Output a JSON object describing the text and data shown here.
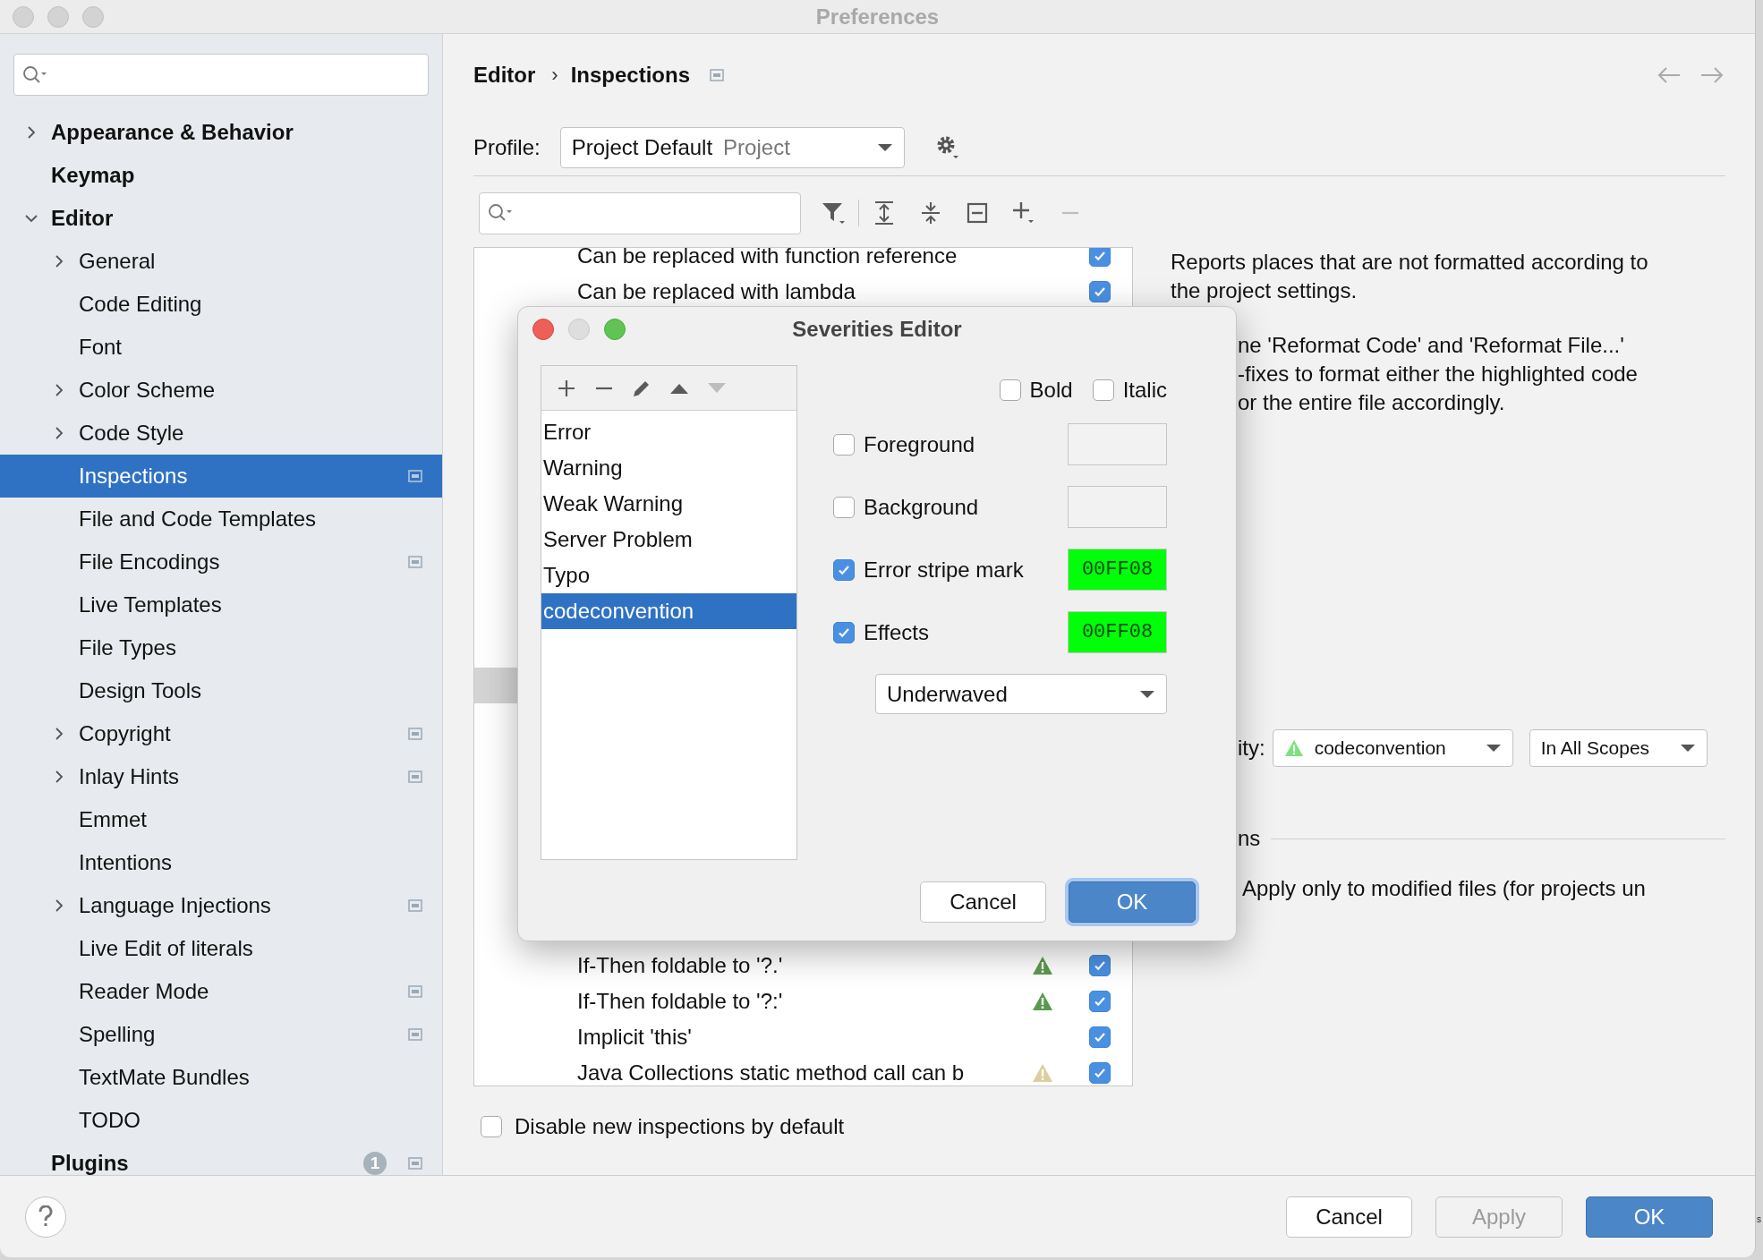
{
  "window": {
    "title": "Preferences"
  },
  "sidebar": {
    "items": [
      {
        "label": "Appearance & Behavior",
        "expandable": true,
        "expanded": false,
        "selected": false,
        "project_scoped": false
      },
      {
        "label": "Keymap",
        "expandable": false,
        "expanded": false,
        "selected": false,
        "project_scoped": false
      },
      {
        "label": "Editor",
        "expandable": true,
        "expanded": true,
        "selected": false,
        "project_scoped": false,
        "children": [
          {
            "label": "General",
            "expandable": true,
            "expanded": false,
            "selected": false,
            "project_scoped": false
          },
          {
            "label": "Code Editing",
            "expandable": false,
            "expanded": false,
            "selected": false,
            "project_scoped": false
          },
          {
            "label": "Font",
            "expandable": false,
            "expanded": false,
            "selected": false,
            "project_scoped": false
          },
          {
            "label": "Color Scheme",
            "expandable": true,
            "expanded": false,
            "selected": false,
            "project_scoped": false
          },
          {
            "label": "Code Style",
            "expandable": true,
            "expanded": false,
            "selected": false,
            "project_scoped": false
          },
          {
            "label": "Inspections",
            "expandable": false,
            "expanded": false,
            "selected": true,
            "project_scoped": true
          },
          {
            "label": "File and Code Templates",
            "expandable": false,
            "expanded": false,
            "selected": false,
            "project_scoped": false
          },
          {
            "label": "File Encodings",
            "expandable": false,
            "expanded": false,
            "selected": false,
            "project_scoped": true
          },
          {
            "label": "Live Templates",
            "expandable": false,
            "expanded": false,
            "selected": false,
            "project_scoped": false
          },
          {
            "label": "File Types",
            "expandable": false,
            "expanded": false,
            "selected": false,
            "project_scoped": false
          },
          {
            "label": "Design Tools",
            "expandable": false,
            "expanded": false,
            "selected": false,
            "project_scoped": false
          },
          {
            "label": "Copyright",
            "expandable": true,
            "expanded": false,
            "selected": false,
            "project_scoped": true
          },
          {
            "label": "Inlay Hints",
            "expandable": true,
            "expanded": false,
            "selected": false,
            "project_scoped": true
          },
          {
            "label": "Emmet",
            "expandable": false,
            "expanded": false,
            "selected": false,
            "project_scoped": false
          },
          {
            "label": "Intentions",
            "expandable": false,
            "expanded": false,
            "selected": false,
            "project_scoped": false
          },
          {
            "label": "Language Injections",
            "expandable": true,
            "expanded": false,
            "selected": false,
            "project_scoped": true
          },
          {
            "label": "Live Edit of literals",
            "expandable": false,
            "expanded": false,
            "selected": false,
            "project_scoped": false
          },
          {
            "label": "Reader Mode",
            "expandable": false,
            "expanded": false,
            "selected": false,
            "project_scoped": true
          },
          {
            "label": "Spelling",
            "expandable": false,
            "expanded": false,
            "selected": false,
            "project_scoped": true
          },
          {
            "label": "TextMate Bundles",
            "expandable": false,
            "expanded": false,
            "selected": false,
            "project_scoped": false
          },
          {
            "label": "TODO",
            "expandable": false,
            "expanded": false,
            "selected": false,
            "project_scoped": false
          }
        ]
      },
      {
        "label": "Plugins",
        "expandable": false,
        "expanded": false,
        "selected": false,
        "project_scoped": true,
        "badge": "1"
      }
    ]
  },
  "page": {
    "breadcrumb": [
      "Editor",
      "Inspections"
    ],
    "breadcrumb_separator": "›",
    "project_scoped": true,
    "profile": {
      "label": "Profile:",
      "value": "Project Default",
      "scope": "Project"
    },
    "toolbar": [
      {
        "kind": "filter",
        "disabled": false
      },
      {
        "kind": "expand",
        "disabled": false
      },
      {
        "kind": "collapse",
        "disabled": false
      },
      {
        "kind": "reset",
        "disabled": false
      },
      {
        "kind": "add",
        "disabled": false
      },
      {
        "kind": "remove",
        "disabled": true
      }
    ],
    "inspections": [
      {
        "label": "Can be replaced with function reference",
        "checked": true,
        "selected": false
      },
      {
        "label": "Can be replaced with lambda",
        "checked": true,
        "selected": false
      },
      {
        "selected": true
      },
      {
        "label": "If-Then foldable to '?.'",
        "checked": true,
        "selected": false,
        "color": "#5b9a4e"
      },
      {
        "label": "If-Then foldable to '?:'",
        "checked": true,
        "selected": false,
        "color": "#5b9a4e"
      },
      {
        "label": "Implicit 'this'",
        "checked": true,
        "selected": false
      },
      {
        "label": "Java Collections static method call can b",
        "checked": true,
        "selected": false,
        "color": "#dccf9f"
      }
    ],
    "description": {
      "paragraph": "Reports places that are not formatted according to the project settings.",
      "partial_lines": [
        "ne 'Reformat Code' and 'Reformat File...'",
        "-fixes to format either the highlighted code",
        "or the entire file accordingly."
      ]
    },
    "severity": {
      "label": "ity:",
      "value": "codeconvention",
      "color": "#7ee07e",
      "scope": "In All Scopes"
    },
    "options": {
      "heading": "ns",
      "apply_only": "Apply only to modified files (for projects un"
    },
    "disable_new": {
      "label": "Disable new inspections by default",
      "checked": false
    }
  },
  "dialog": {
    "title": "Severities Editor",
    "toolbar": [
      {
        "kind": "add",
        "disabled": false
      },
      {
        "kind": "remove",
        "disabled": false
      },
      {
        "kind": "edit",
        "disabled": false
      },
      {
        "kind": "up",
        "disabled": false
      },
      {
        "kind": "down",
        "disabled": true
      }
    ],
    "severities": [
      {
        "label": "Error",
        "selected": false
      },
      {
        "label": "Warning",
        "selected": false
      },
      {
        "label": "Weak Warning",
        "selected": false
      },
      {
        "label": "Server Problem",
        "selected": false
      },
      {
        "label": "Typo",
        "selected": false
      },
      {
        "label": "codeconvention",
        "selected": true
      }
    ],
    "font_styles": [
      {
        "label": "Bold",
        "checked": false
      },
      {
        "label": "Italic",
        "checked": false
      }
    ],
    "attributes": [
      {
        "label": "Foreground",
        "checked": false
      },
      {
        "label": "Background",
        "checked": false
      },
      {
        "label": "Error stripe mark",
        "checked": true,
        "value": "00FF08",
        "color": "#00ff08"
      },
      {
        "label": "Effects",
        "checked": true,
        "value": "00FF08",
        "color": "#00ff08"
      }
    ],
    "effect": "Underwaved",
    "buttons": [
      {
        "label": "Cancel",
        "kind": "default"
      },
      {
        "label": "OK",
        "kind": "primary"
      }
    ]
  },
  "footer": {
    "buttons": [
      {
        "label": "Cancel",
        "kind": "default",
        "disabled": false
      },
      {
        "label": "Apply",
        "kind": "default",
        "disabled": true
      },
      {
        "label": "OK",
        "kind": "primary",
        "disabled": false
      }
    ]
  },
  "background_fragment": "s"
}
